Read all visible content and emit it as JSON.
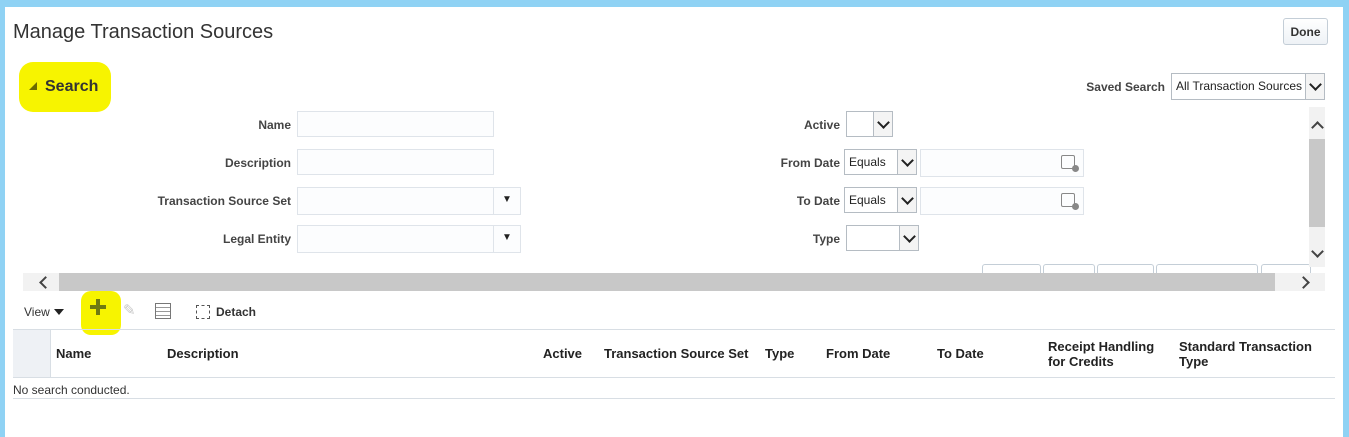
{
  "page": {
    "title": "Manage Transaction Sources",
    "done_label": "Done"
  },
  "search": {
    "header": "Search",
    "saved_search_label": "Saved Search",
    "saved_search_value": "All Transaction Sources",
    "fields": {
      "name_label": "Name",
      "description_label": "Description",
      "transaction_source_set_label": "Transaction Source Set",
      "legal_entity_label": "Legal Entity",
      "active_label": "Active",
      "from_date_label": "From Date",
      "from_date_operator": "Equals",
      "to_date_label": "To Date",
      "to_date_operator": "Equals",
      "type_label": "Type"
    }
  },
  "toolbar": {
    "view_label": "View",
    "detach_label": "Detach"
  },
  "table": {
    "columns": [
      "Name",
      "Description",
      "Active",
      "Transaction Source Set",
      "Type",
      "From Date",
      "To Date",
      "Receipt Handling for Credits",
      "Standard Transaction Type"
    ],
    "empty_message": "No search conducted."
  },
  "colors": {
    "highlight": "#f7f400",
    "frame": "#8fd2f4"
  }
}
